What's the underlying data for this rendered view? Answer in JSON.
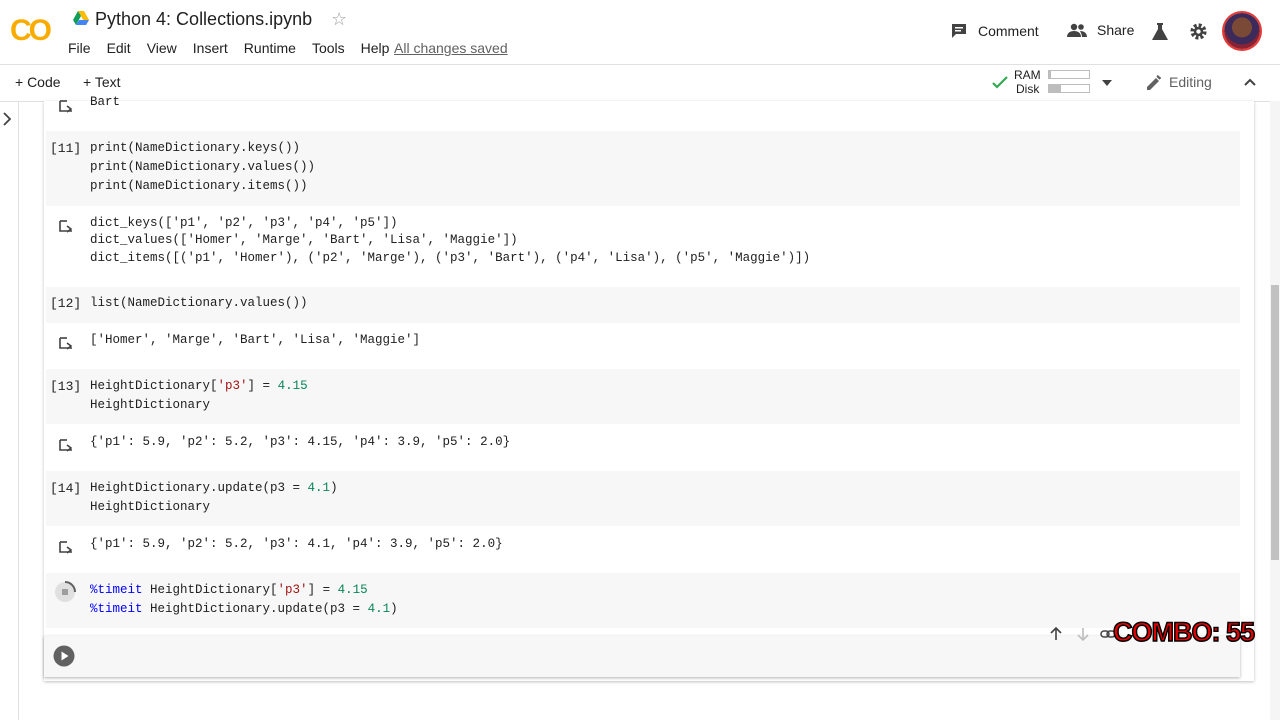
{
  "header": {
    "logo_text": "CO",
    "title": "Python 4: Collections.ipynb",
    "menu": [
      "File",
      "Edit",
      "View",
      "Insert",
      "Runtime",
      "Tools",
      "Help"
    ],
    "saved_status": "All changes saved",
    "comment_label": "Comment",
    "share_label": "Share"
  },
  "toolbar": {
    "code_label": "+ Code",
    "text_label": "+ Text",
    "ram_label": "RAM",
    "disk_label": "Disk",
    "ram_fraction": 0.05,
    "disk_fraction": 0.3,
    "editing_label": "Editing"
  },
  "cells": {
    "prev_output": "Bart",
    "c11": {
      "exec": "[11]",
      "line1": "print(NameDictionary.keys())",
      "line2": "print(NameDictionary.values())",
      "line3": "print(NameDictionary.items())",
      "out1": "dict_keys(['p1', 'p2', 'p3', 'p4', 'p5'])",
      "out2": "dict_values(['Homer', 'Marge', 'Bart', 'Lisa', 'Maggie'])",
      "out3": "dict_items([('p1', 'Homer'), ('p2', 'Marge'), ('p3', 'Bart'), ('p4', 'Lisa'), ('p5', 'Maggie')])"
    },
    "c12": {
      "exec": "[12]",
      "line1": "list(NameDictionary.values())",
      "out1": "['Homer', 'Marge', 'Bart', 'Lisa', 'Maggie']"
    },
    "c13": {
      "exec": "[13]",
      "line1_a": "HeightDictionary[",
      "line1_b": "'p3'",
      "line1_c": "] = ",
      "line1_d": "4.15",
      "line2": "HeightDictionary",
      "out1": "{'p1': 5.9, 'p2': 5.2, 'p3': 4.15, 'p4': 3.9, 'p5': 2.0}"
    },
    "c14": {
      "exec": "[14]",
      "line1_a": "HeightDictionary.update(p3 = ",
      "line1_b": "4.1",
      "line1_c": ")",
      "line2": "HeightDictionary",
      "out1": "{'p1': 5.9, 'p2': 5.2, 'p3': 4.1, 'p4': 3.9, 'p5': 2.0}"
    },
    "c15": {
      "line1_a": "%timeit",
      "line1_b": " HeightDictionary[",
      "line1_c": "'p3'",
      "line1_d": "] = ",
      "line1_e": "4.15",
      "line2_a": "%timeit",
      "line2_b": " HeightDictionary.update(p3 = ",
      "line2_c": "4.1",
      "line2_d": ")"
    }
  },
  "overlay": {
    "combo_text": "COMBO: 55"
  }
}
